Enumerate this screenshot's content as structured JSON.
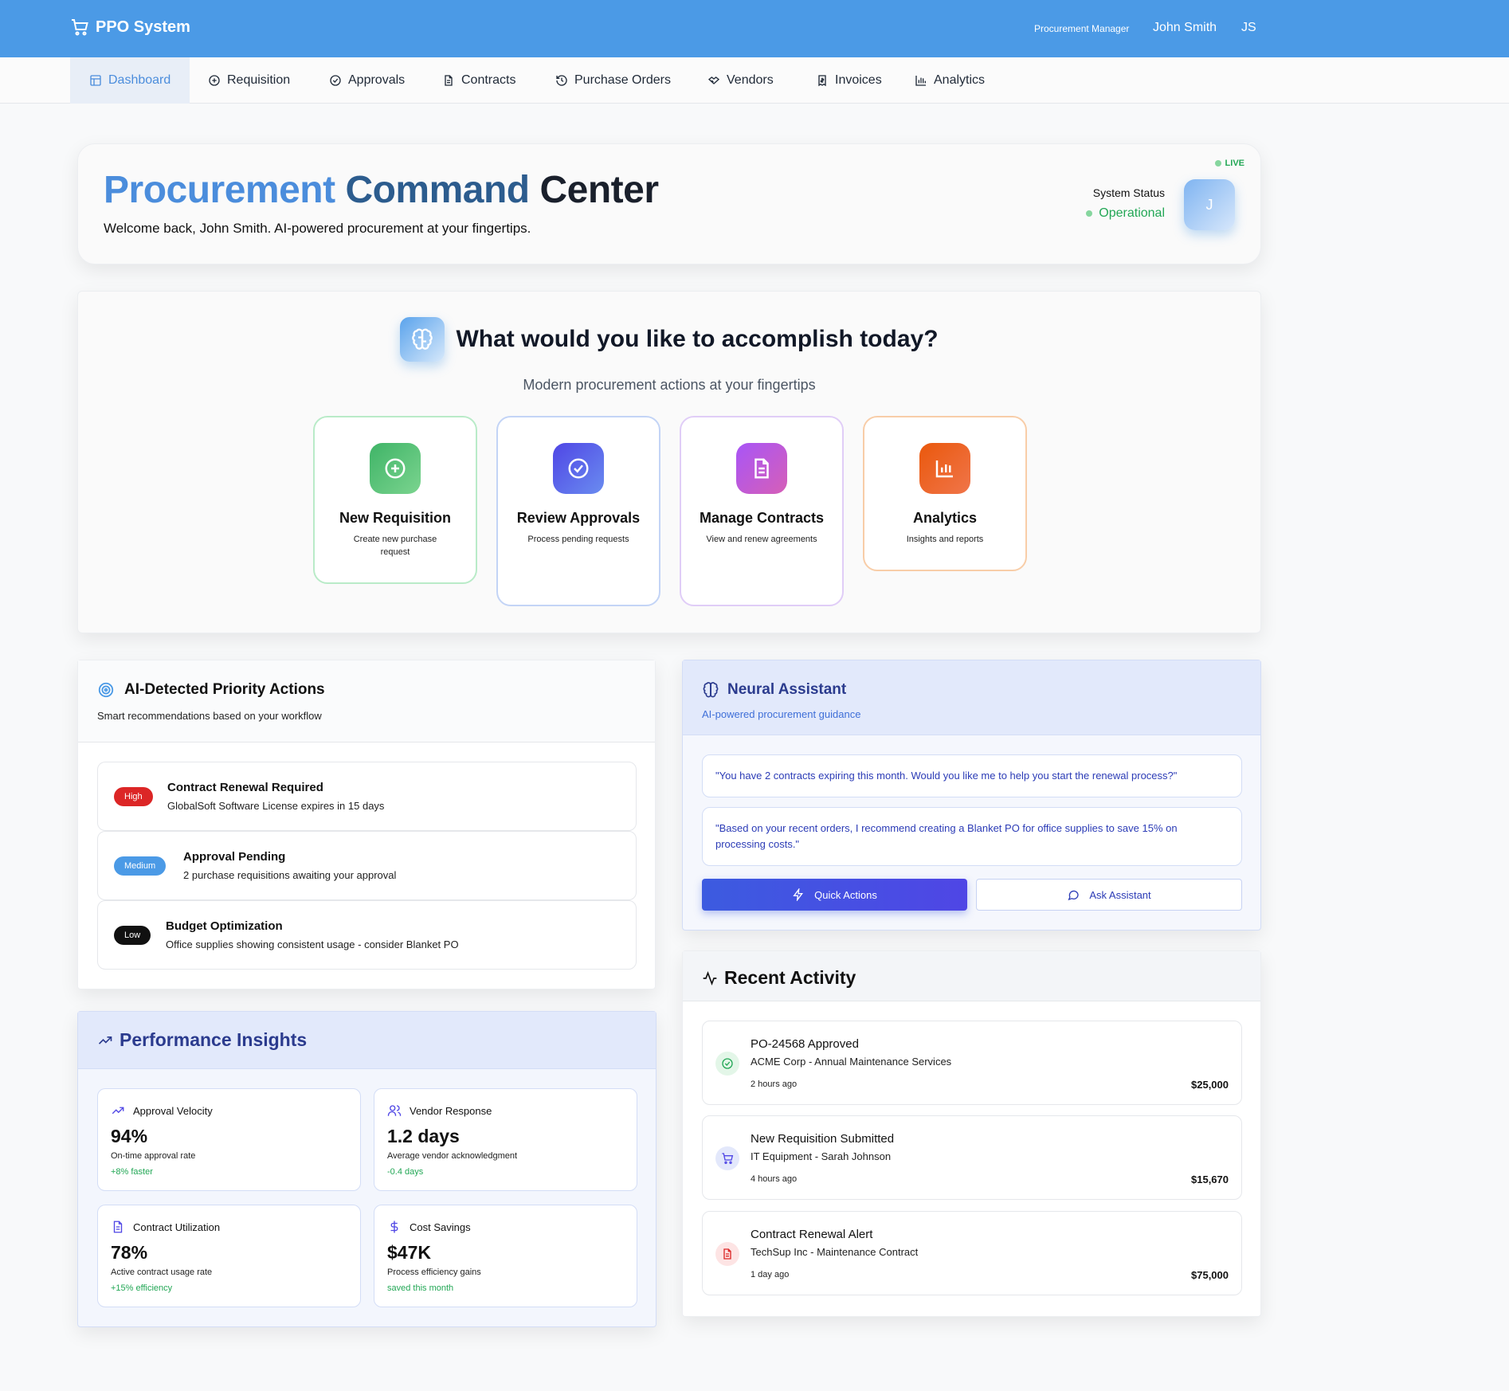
{
  "header": {
    "brand": "PPO System",
    "user_role": "Procurement Manager",
    "user_name": "John Smith",
    "user_initials": "JS"
  },
  "nav": {
    "items": [
      {
        "label": "Dashboard",
        "icon": "layout-icon",
        "active": true
      },
      {
        "label": "Requisition",
        "icon": "plus-circle-icon"
      },
      {
        "label": "Approvals",
        "icon": "check-circle-icon"
      },
      {
        "label": "Contracts",
        "icon": "file-icon"
      },
      {
        "label": "Purchase Orders",
        "icon": "history-icon"
      },
      {
        "label": "Vendors",
        "icon": "handshake-icon"
      },
      {
        "label": "Invoices",
        "icon": "receipt-icon"
      },
      {
        "label": "Analytics",
        "icon": "bar-chart-icon"
      }
    ]
  },
  "hero": {
    "title_part1": "Procurement",
    "title_part2": "Command",
    "title_part3": "Center",
    "subtitle": "Welcome back, John Smith. AI-powered procurement at your fingertips.",
    "live_label": "LIVE",
    "status_label": "System Status",
    "status_value": "Operational",
    "avatar_initial": "J"
  },
  "quick_actions": {
    "title": "What would you like to accomplish today?",
    "subtitle": "Modern procurement actions at your fingertips",
    "cards": [
      {
        "title": "New Requisition",
        "desc": "Create new purchase request",
        "color": "#22a755",
        "icon": "plus-circle-icon"
      },
      {
        "title": "Review Approvals",
        "desc": "Process pending requests",
        "color": "#4f46e5",
        "icon": "check-circle-icon"
      },
      {
        "title": "Manage Contracts",
        "desc": "View and renew agreements",
        "color": "#a855f7",
        "icon": "file-icon"
      },
      {
        "title": "Analytics",
        "desc": "Insights and reports",
        "color": "#ea580c",
        "icon": "bar-chart-icon"
      }
    ]
  },
  "priority": {
    "title": "AI-Detected Priority Actions",
    "subtitle": "Smart recommendations based on your workflow",
    "items": [
      {
        "badge": "High",
        "badge_color": "#dc2626",
        "title": "Contract Renewal Required",
        "desc": "GlobalSoft Software License expires in 15 days"
      },
      {
        "badge": "Medium",
        "badge_color": "#4b9ae6",
        "title": "Approval Pending",
        "desc": "2 purchase requisitions awaiting your approval"
      },
      {
        "badge": "Low",
        "badge_color": "#111111",
        "title": "Budget Optimization",
        "desc": "Office supplies showing consistent usage - consider Blanket PO"
      }
    ]
  },
  "assistant": {
    "title": "Neural Assistant",
    "subtitle": "AI-powered procurement guidance",
    "messages": [
      "\"You have 2 contracts expiring this month. Would you like me to help you start the renewal process?\"",
      "\"Based on your recent orders, I recommend creating a Blanket PO for office supplies to save 15% on processing costs.\""
    ],
    "quick_actions_label": "Quick Actions",
    "ask_label": "Ask Assistant"
  },
  "performance": {
    "title": "Performance Insights",
    "metrics": [
      {
        "label": "Approval Velocity",
        "value": "94%",
        "desc": "On-time approval rate",
        "trend": "+8% faster",
        "icon": "trending-up-icon"
      },
      {
        "label": "Vendor Response",
        "value": "1.2 days",
        "desc": "Average vendor acknowledgment",
        "trend": "-0.4 days",
        "icon": "users-icon"
      },
      {
        "label": "Contract Utilization",
        "value": "78%",
        "desc": "Active contract usage rate",
        "trend": "+15% efficiency",
        "icon": "file-icon"
      },
      {
        "label": "Cost Savings",
        "value": "$47K",
        "desc": "Process efficiency gains",
        "trend": "saved this month",
        "icon": "dollar-icon"
      }
    ]
  },
  "activity": {
    "title": "Recent Activity",
    "items": [
      {
        "title": "PO-24568 Approved",
        "desc": "ACME Corp - Annual Maintenance Services",
        "time": "2 hours ago",
        "amount": "$25,000",
        "icon": "check-circle-icon",
        "color": "#22a755"
      },
      {
        "title": "New Requisition Submitted",
        "desc": "IT Equipment - Sarah Johnson",
        "time": "4 hours ago",
        "amount": "$15,670",
        "icon": "cart-icon",
        "color": "#4f46e5"
      },
      {
        "title": "Contract Renewal Alert",
        "desc": "TechSup Inc - Maintenance Contract",
        "time": "1 day ago",
        "amount": "$75,000",
        "icon": "file-icon",
        "color": "#dc2626"
      }
    ]
  }
}
